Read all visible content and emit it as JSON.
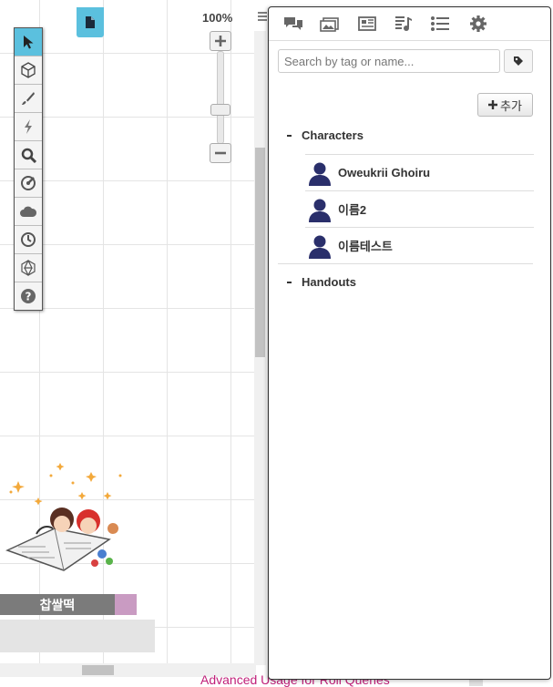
{
  "canvas": {
    "zoom_label": "100%",
    "token": {
      "name": "찹쌀떡"
    },
    "bottom_link": "Advanced Usage for Roll Queries"
  },
  "toolbar": {
    "tools": [
      "select-icon",
      "cube-icon",
      "brush-icon",
      "lightning-icon",
      "zoom-icon",
      "measure-icon",
      "fog-icon",
      "clock-icon",
      "dice-icon",
      "help-icon"
    ]
  },
  "sidebar": {
    "tabs": [
      "chat-icon",
      "art-library-icon",
      "journal-icon",
      "jukebox-icon",
      "list-icon",
      "settings-icon"
    ],
    "search": {
      "placeholder": "Search by tag or name...",
      "value": ""
    },
    "add_button_label": "추가",
    "folders": [
      {
        "label": "Characters",
        "items": [
          "Oweukrii Ghoiru",
          "이름2",
          "이름테스트"
        ]
      },
      {
        "label": "Handouts",
        "items": []
      }
    ]
  },
  "colors": {
    "accent": "#5bc0de",
    "avatar": "#2a2f6b",
    "link": "#c0207a"
  }
}
